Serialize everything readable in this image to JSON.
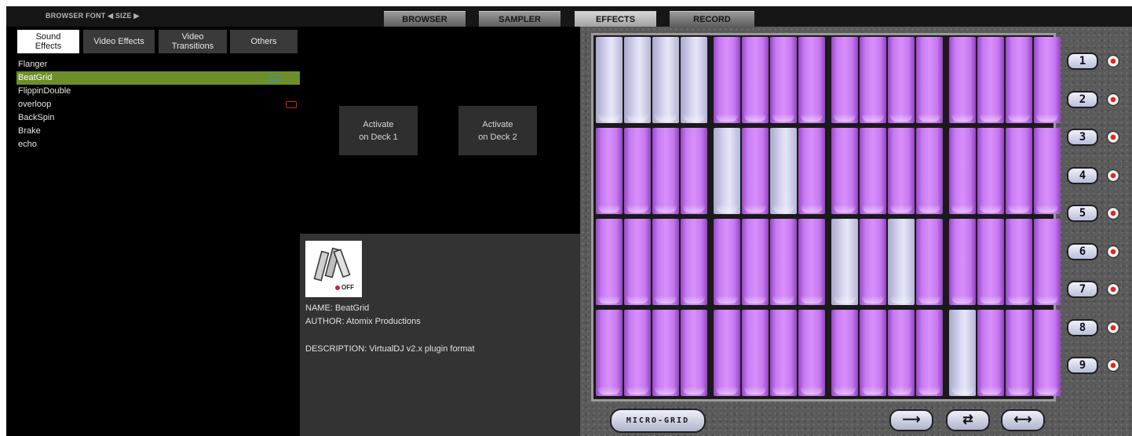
{
  "topbar": {
    "font_size_label": "BROWSER FONT ◀ SIZE ▶",
    "tabs": [
      "BROWSER",
      "SAMPLER",
      "EFFECTS",
      "RECORD"
    ],
    "active_tab": "EFFECTS"
  },
  "categories": [
    {
      "line1": "Sound",
      "line2": "Effects",
      "active": true
    },
    {
      "line1": "Video Effects",
      "line2": "",
      "active": false
    },
    {
      "line1": "Video",
      "line2": "Transitions",
      "active": false
    },
    {
      "line1": "Others",
      "line2": "",
      "active": false
    }
  ],
  "effects_list": [
    "Flanger",
    "BeatGrid",
    "FlippinDouble",
    "overloop",
    "BackSpin",
    "Brake",
    "echo"
  ],
  "selected_effect": "BeatGrid",
  "deck_buttons": {
    "deck1_line1": "Activate",
    "deck1_line2": "on Deck 1",
    "deck2_line1": "Activate",
    "deck2_line2": "on Deck 2"
  },
  "info": {
    "logo_text": "OFF",
    "name": "NAME: BeatGrid",
    "author": "AUTHOR: Atomix Productions",
    "description": "DESCRIPTION: VirtualDJ v2.x plugin format"
  },
  "plugin": {
    "preset_buttons": [
      "1",
      "2",
      "3",
      "4",
      "5",
      "6",
      "7",
      "8",
      "9"
    ],
    "micro_grid_label": "MICRO-GRID",
    "arrow_buttons": [
      "⟶",
      "⇄",
      "⟷"
    ],
    "grid_pattern": [
      [
        "L",
        "L",
        "L",
        "L",
        "P",
        "P",
        "P",
        "P",
        "P",
        "P",
        "P",
        "P",
        "P",
        "P",
        "P",
        "P"
      ],
      [
        "P",
        "P",
        "P",
        "P",
        "L",
        "P",
        "L",
        "P",
        "P",
        "P",
        "P",
        "P",
        "P",
        "P",
        "P",
        "P"
      ],
      [
        "P",
        "P",
        "P",
        "P",
        "P",
        "P",
        "P",
        "P",
        "L",
        "P",
        "L",
        "P",
        "P",
        "P",
        "P",
        "P"
      ],
      [
        "P",
        "P",
        "P",
        "P",
        "P",
        "P",
        "P",
        "P",
        "P",
        "P",
        "P",
        "P",
        "L",
        "P",
        "P",
        "P"
      ]
    ],
    "colors": {
      "purple": "#c67cf0",
      "lavender": "#dcdcf3",
      "selection": "#6d8f2a"
    }
  }
}
